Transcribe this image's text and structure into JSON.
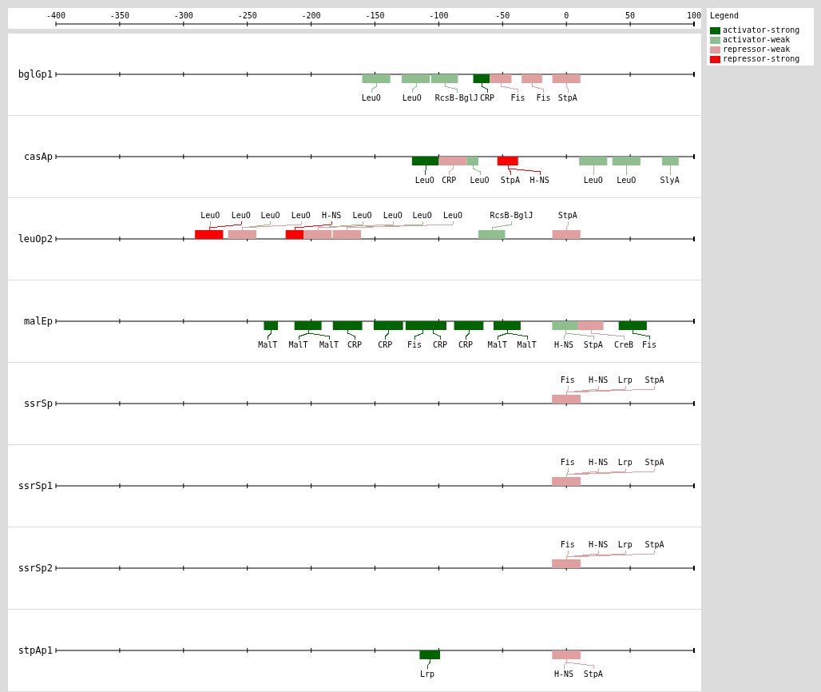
{
  "legend": {
    "title": "Legend",
    "items": [
      {
        "label": "activator-strong",
        "color": "#006400"
      },
      {
        "label": "activator-weak",
        "color": "#8fbf8f"
      },
      {
        "label": "repressor-weak",
        "color": "#e0a0a0"
      },
      {
        "label": "repressor-strong",
        "color": "#ff0000"
      }
    ]
  },
  "plot": {
    "scale": [
      "-400",
      "-350",
      "-300",
      "-250",
      "-200",
      "-150",
      "-100",
      "-50",
      "0",
      "50",
      "100"
    ],
    "promoters": [
      {
        "name": "bglGp1",
        "kind": "below",
        "sites": [
          {
            "label": "LeuO",
            "color": "#8fbf8f"
          },
          {
            "label": "LeuO",
            "color": "#8fbf8f"
          },
          {
            "label": "RcsB-BglJ",
            "color": "#8fbf8f"
          },
          {
            "label": "CRP",
            "color": "#006400"
          },
          {
            "label": "Fis",
            "color": "#e0a0a0"
          },
          {
            "label": "Fis",
            "color": "#e0a0a0"
          },
          {
            "label": "StpA",
            "color": "#e0a0a0"
          }
        ]
      },
      {
        "name": "casAp",
        "kind": "below",
        "sites": [
          {
            "label": "LeuO",
            "color": "#006400"
          },
          {
            "label": "CRP",
            "color": "#e0a0a0"
          },
          {
            "label": "LeuO",
            "color": "#8fbf8f"
          },
          {
            "label": "StpA",
            "color": "#ff0000"
          },
          {
            "label": "H-NS",
            "color": "#ff0000"
          },
          {
            "label": "LeuO",
            "color": "#8fbf8f"
          },
          {
            "label": "LeuO",
            "color": "#8fbf8f"
          },
          {
            "label": "SlyA",
            "color": "#8fbf8f"
          }
        ]
      },
      {
        "name": "leuOp2",
        "kind": "above",
        "sites": [
          {
            "label": "LeuO",
            "color": "#8fbf8f"
          },
          {
            "label": "LeuO",
            "color": "#ff0000"
          },
          {
            "label": "LeuO",
            "color": "#8fbf8f"
          },
          {
            "label": "LeuO",
            "color": "#e0a0a0"
          },
          {
            "label": "H-NS",
            "color": "#ff0000"
          },
          {
            "label": "LeuO",
            "color": "#8fbf8f"
          },
          {
            "label": "LeuO",
            "color": "#e0a0a0"
          },
          {
            "label": "LeuO",
            "color": "#8fbf8f"
          },
          {
            "label": "LeuO",
            "color": "#e0a0a0"
          },
          {
            "label": "RcsB-BglJ",
            "color": "#8fbf8f"
          },
          {
            "label": "StpA",
            "color": "#e0a0a0"
          }
        ]
      },
      {
        "name": "malEp",
        "kind": "below",
        "sites": [
          {
            "label": "MalT",
            "color": "#006400"
          },
          {
            "label": "MalT",
            "color": "#006400"
          },
          {
            "label": "MalT",
            "color": "#006400"
          },
          {
            "label": "CRP",
            "color": "#006400"
          },
          {
            "label": "CRP",
            "color": "#006400"
          },
          {
            "label": "Fis",
            "color": "#006400"
          },
          {
            "label": "CRP",
            "color": "#006400"
          },
          {
            "label": "CRP",
            "color": "#006400"
          },
          {
            "label": "MalT",
            "color": "#006400"
          },
          {
            "label": "MalT",
            "color": "#006400"
          },
          {
            "label": "H-NS",
            "color": "#8fbf8f"
          },
          {
            "label": "StpA",
            "color": "#8fbf8f"
          },
          {
            "label": "CreB",
            "color": "#e0a0a0"
          },
          {
            "label": "Fis",
            "color": "#006400"
          }
        ]
      },
      {
        "name": "ssrSp",
        "kind": "above",
        "sites": [
          {
            "label": "Fis",
            "color": "#e0a0a0"
          },
          {
            "label": "H-NS",
            "color": "#e0a0a0"
          },
          {
            "label": "Lrp",
            "color": "#e0a0a0"
          },
          {
            "label": "StpA",
            "color": "#e0a0a0"
          }
        ]
      },
      {
        "name": "ssrSp1",
        "kind": "above",
        "sites": [
          {
            "label": "Fis",
            "color": "#8fbf8f"
          },
          {
            "label": "H-NS",
            "color": "#e0a0a0"
          },
          {
            "label": "Lrp",
            "color": "#e0a0a0"
          },
          {
            "label": "StpA",
            "color": "#e0a0a0"
          }
        ]
      },
      {
        "name": "ssrSp2",
        "kind": "above",
        "sites": [
          {
            "label": "Fis",
            "color": "#e0a0a0"
          },
          {
            "label": "H-NS",
            "color": "#e0a0a0"
          },
          {
            "label": "Lrp",
            "color": "#e0a0a0"
          },
          {
            "label": "StpA",
            "color": "#e0a0a0"
          }
        ]
      },
      {
        "name": "stpAp1",
        "kind": "below",
        "sites": [
          {
            "label": "Lrp",
            "color": "#006400"
          },
          {
            "label": "H-NS",
            "color": "#e0a0a0"
          },
          {
            "label": "StpA",
            "color": "#e0a0a0"
          }
        ]
      }
    ]
  }
}
